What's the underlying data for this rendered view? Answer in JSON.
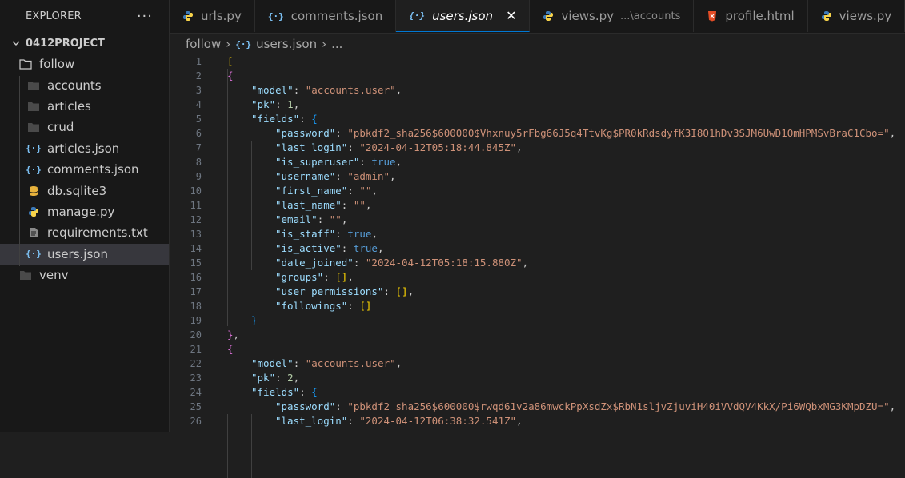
{
  "sidebar": {
    "title": "EXPLORER",
    "more": "···",
    "project": "0412PROJECT",
    "items": [
      {
        "label": "follow",
        "icon": "folder-open-icon",
        "depth": 0
      },
      {
        "label": "accounts",
        "icon": "folder-icon",
        "depth": 1
      },
      {
        "label": "articles",
        "icon": "folder-icon",
        "depth": 1
      },
      {
        "label": "crud",
        "icon": "folder-icon",
        "depth": 1
      },
      {
        "label": "articles.json",
        "icon": "json-icon",
        "depth": 1
      },
      {
        "label": "comments.json",
        "icon": "json-icon",
        "depth": 1
      },
      {
        "label": "db.sqlite3",
        "icon": "database-icon",
        "depth": 1
      },
      {
        "label": "manage.py",
        "icon": "python-icon",
        "depth": 1
      },
      {
        "label": "requirements.txt",
        "icon": "text-file-icon",
        "depth": 1
      },
      {
        "label": "users.json",
        "icon": "json-icon",
        "depth": 1,
        "active": true
      },
      {
        "label": "venv",
        "icon": "folder-icon",
        "depth": 0
      }
    ]
  },
  "tabs": [
    {
      "label": "urls.py",
      "icon": "python-icon",
      "desc": ""
    },
    {
      "label": "comments.json",
      "icon": "json-icon",
      "desc": ""
    },
    {
      "label": "users.json",
      "icon": "json-icon",
      "desc": "",
      "active": true,
      "close": "✕"
    },
    {
      "label": "views.py",
      "icon": "python-icon",
      "desc": "...\\accounts"
    },
    {
      "label": "profile.html",
      "icon": "html-icon",
      "desc": ""
    },
    {
      "label": "views.py",
      "icon": "python-icon",
      "desc": ""
    }
  ],
  "breadcrumb": [
    "follow",
    "users.json",
    "..."
  ],
  "editor": {
    "lines": [
      {
        "n": "1",
        "ind": 0,
        "t": [
          [
            "br1",
            "["
          ]
        ]
      },
      {
        "n": "2",
        "ind": 0,
        "t": [
          [
            "br2",
            "{"
          ]
        ]
      },
      {
        "n": "3",
        "ind": 1,
        "t": [
          [
            "k",
            "\"model\""
          ],
          [
            "p",
            ": "
          ],
          [
            "s",
            "\"accounts.user\""
          ],
          [
            "p",
            ","
          ]
        ]
      },
      {
        "n": "4",
        "ind": 1,
        "t": [
          [
            "k",
            "\"pk\""
          ],
          [
            "p",
            ": "
          ],
          [
            "n",
            "1"
          ],
          [
            "p",
            ","
          ]
        ]
      },
      {
        "n": "5",
        "ind": 1,
        "t": [
          [
            "k",
            "\"fields\""
          ],
          [
            "p",
            ": "
          ],
          [
            "br3",
            "{"
          ]
        ]
      },
      {
        "n": "6",
        "ind": 2,
        "t": [
          [
            "k",
            "\"password\""
          ],
          [
            "p",
            ": "
          ],
          [
            "s",
            "\"pbkdf2_sha256$600000$Vhxnuy5rFbg66J5q4TtvKg$PR0kRdsdyfK3I8O1hDv3SJM6UwD1OmHPMSvBraC1Cbo=\""
          ],
          [
            "p",
            ","
          ]
        ]
      },
      {
        "n": "7",
        "ind": 2,
        "t": [
          [
            "k",
            "\"last_login\""
          ],
          [
            "p",
            ": "
          ],
          [
            "s",
            "\"2024-04-12T05:18:44.845Z\""
          ],
          [
            "p",
            ","
          ]
        ]
      },
      {
        "n": "8",
        "ind": 2,
        "t": [
          [
            "k",
            "\"is_superuser\""
          ],
          [
            "p",
            ": "
          ],
          [
            "b",
            "true"
          ],
          [
            "p",
            ","
          ]
        ]
      },
      {
        "n": "9",
        "ind": 2,
        "t": [
          [
            "k",
            "\"username\""
          ],
          [
            "p",
            ": "
          ],
          [
            "s",
            "\"admin\""
          ],
          [
            "p",
            ","
          ]
        ]
      },
      {
        "n": "10",
        "ind": 2,
        "t": [
          [
            "k",
            "\"first_name\""
          ],
          [
            "p",
            ": "
          ],
          [
            "s",
            "\"\""
          ],
          [
            "p",
            ","
          ]
        ]
      },
      {
        "n": "11",
        "ind": 2,
        "t": [
          [
            "k",
            "\"last_name\""
          ],
          [
            "p",
            ": "
          ],
          [
            "s",
            "\"\""
          ],
          [
            "p",
            ","
          ]
        ]
      },
      {
        "n": "12",
        "ind": 2,
        "t": [
          [
            "k",
            "\"email\""
          ],
          [
            "p",
            ": "
          ],
          [
            "s",
            "\"\""
          ],
          [
            "p",
            ","
          ]
        ]
      },
      {
        "n": "13",
        "ind": 2,
        "t": [
          [
            "k",
            "\"is_staff\""
          ],
          [
            "p",
            ": "
          ],
          [
            "b",
            "true"
          ],
          [
            "p",
            ","
          ]
        ]
      },
      {
        "n": "14",
        "ind": 2,
        "t": [
          [
            "k",
            "\"is_active\""
          ],
          [
            "p",
            ": "
          ],
          [
            "b",
            "true"
          ],
          [
            "p",
            ","
          ]
        ]
      },
      {
        "n": "15",
        "ind": 2,
        "t": [
          [
            "k",
            "\"date_joined\""
          ],
          [
            "p",
            ": "
          ],
          [
            "s",
            "\"2024-04-12T05:18:15.880Z\""
          ],
          [
            "p",
            ","
          ]
        ]
      },
      {
        "n": "16",
        "ind": 2,
        "t": [
          [
            "k",
            "\"groups\""
          ],
          [
            "p",
            ": "
          ],
          [
            "br1",
            "[]"
          ],
          [
            "p",
            ","
          ]
        ]
      },
      {
        "n": "17",
        "ind": 2,
        "t": [
          [
            "k",
            "\"user_permissions\""
          ],
          [
            "p",
            ": "
          ],
          [
            "br1",
            "[]"
          ],
          [
            "p",
            ","
          ]
        ]
      },
      {
        "n": "18",
        "ind": 2,
        "t": [
          [
            "k",
            "\"followings\""
          ],
          [
            "p",
            ": "
          ],
          [
            "br1",
            "[]"
          ]
        ]
      },
      {
        "n": "19",
        "ind": 1,
        "t": [
          [
            "br3",
            "}"
          ]
        ]
      },
      {
        "n": "20",
        "ind": 0,
        "t": [
          [
            "br2",
            "}"
          ],
          [
            "p",
            ","
          ]
        ]
      },
      {
        "n": "21",
        "ind": 0,
        "t": [
          [
            "br2",
            "{"
          ]
        ]
      },
      {
        "n": "22",
        "ind": 1,
        "t": [
          [
            "k",
            "\"model\""
          ],
          [
            "p",
            ": "
          ],
          [
            "s",
            "\"accounts.user\""
          ],
          [
            "p",
            ","
          ]
        ]
      },
      {
        "n": "23",
        "ind": 1,
        "t": [
          [
            "k",
            "\"pk\""
          ],
          [
            "p",
            ": "
          ],
          [
            "n",
            "2"
          ],
          [
            "p",
            ","
          ]
        ]
      },
      {
        "n": "24",
        "ind": 1,
        "t": [
          [
            "k",
            "\"fields\""
          ],
          [
            "p",
            ": "
          ],
          [
            "br3",
            "{"
          ]
        ]
      },
      {
        "n": "25",
        "ind": 2,
        "t": [
          [
            "k",
            "\"password\""
          ],
          [
            "p",
            ": "
          ],
          [
            "s",
            "\"pbkdf2_sha256$600000$rwqd61v2a86mwckPpXsdZx$RbN1sljvZjuviH40iVVdQV4KkX/Pi6WQbxMG3KMpDZU=\""
          ],
          [
            "p",
            ","
          ]
        ]
      },
      {
        "n": "26",
        "ind": 2,
        "t": [
          [
            "k",
            "\"last_login\""
          ],
          [
            "p",
            ": "
          ],
          [
            "s",
            "\"2024-04-12T06:38:32.541Z\""
          ],
          [
            "p",
            ","
          ]
        ]
      }
    ]
  },
  "colors": {
    "accent": "#0078d4",
    "json_icon": "#7ec4f8",
    "python_blue": "#3d7ab8",
    "python_yellow": "#f7d34a",
    "html_icon": "#e44d26",
    "db_icon": "#e8b23c"
  }
}
